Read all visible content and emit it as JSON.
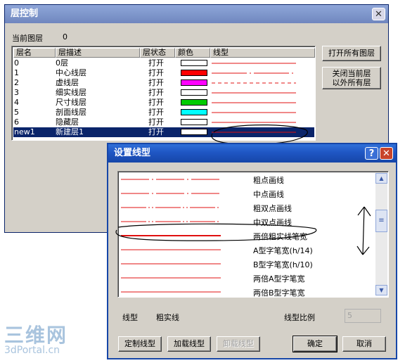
{
  "layer_window": {
    "title": "层控制",
    "current_layer_label": "当前图层",
    "current_layer_value": "0",
    "columns": [
      "层名",
      "层描述",
      "层状态",
      "颜色",
      "线型"
    ],
    "rows": [
      {
        "name": "0",
        "desc": "0层",
        "state": "打开",
        "color": "#ffffff",
        "line": "solid"
      },
      {
        "name": "1",
        "desc": "中心线层",
        "state": "打开",
        "color": "#ff0000",
        "line": "center"
      },
      {
        "name": "2",
        "desc": "虚线层",
        "state": "打开",
        "color": "#ff00ff",
        "line": "dashed"
      },
      {
        "name": "3",
        "desc": "细实线层",
        "state": "打开",
        "color": "#ffffff",
        "line": "solid"
      },
      {
        "name": "4",
        "desc": "尺寸线层",
        "state": "打开",
        "color": "#00cc00",
        "line": "solid"
      },
      {
        "name": "5",
        "desc": "剖面线层",
        "state": "打开",
        "color": "#00ffff",
        "line": "solid"
      },
      {
        "name": "6",
        "desc": "隐藏层",
        "state": "打开",
        "color": "#ffffff",
        "line": "solid"
      },
      {
        "name": "new1",
        "desc": "新建层1",
        "state": "打开",
        "color": "#ffffff",
        "line": "solid",
        "selected": true
      }
    ],
    "open_all_button": "打开所有图层",
    "close_others_button_line1": "关闭当前层",
    "close_others_button_line2": "以外所有层"
  },
  "linetype_dialog": {
    "title": "设置线型",
    "items": [
      {
        "name": "粗点画线",
        "pattern": "dashdot"
      },
      {
        "name": "中点画线",
        "pattern": "dashdot"
      },
      {
        "name": "粗双点画线",
        "pattern": "dashdotdot"
      },
      {
        "name": "中双点画线",
        "pattern": "dashdotdot"
      },
      {
        "name": "两倍粗实线笔宽",
        "pattern": "thick"
      },
      {
        "name": "A型字笔宽(h/14)",
        "pattern": "solid"
      },
      {
        "name": "B型字笔宽(h/10)",
        "pattern": "solid"
      },
      {
        "name": "两倍A型字笔宽",
        "pattern": "solid"
      },
      {
        "name": "两倍B型字笔宽",
        "pattern": "solid"
      }
    ],
    "linetype_label": "线型",
    "linetype_value": "粗实线",
    "scale_label": "线型比例",
    "scale_value": "5",
    "custom_button": "定制线型",
    "load_button": "加载线型",
    "unload_button": "卸载线型",
    "ok_button": "确定",
    "cancel_button": "取消"
  },
  "watermark": {
    "main": "三维网",
    "sub": "3dPortal.cn"
  },
  "colors": {
    "line_red": "#e01010",
    "title_blue": "#1f56c4",
    "selection": "#0a246a"
  }
}
